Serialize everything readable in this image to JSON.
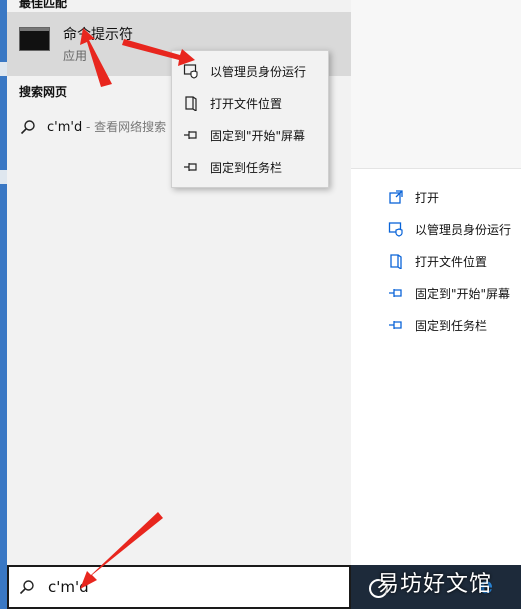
{
  "left_pane": {
    "best_match_header": "最佳匹配",
    "top_result": {
      "title": "命令提示符",
      "subtitle": "应用"
    },
    "web_header": "搜索网页",
    "web_result": {
      "query": "c'm'd",
      "hint": " - 查看网络搜索"
    }
  },
  "context_menu": {
    "items": [
      {
        "label": "以管理员身份运行",
        "icon": "shield-icon"
      },
      {
        "label": "打开文件位置",
        "icon": "file-location-icon"
      },
      {
        "label": "固定到\"开始\"屏幕",
        "icon": "pin-icon"
      },
      {
        "label": "固定到任务栏",
        "icon": "pin-icon"
      }
    ]
  },
  "right_pane": {
    "actions": [
      {
        "label": "打开",
        "icon": "open-icon"
      },
      {
        "label": "以管理员身份运行",
        "icon": "shield-icon"
      },
      {
        "label": "打开文件位置",
        "icon": "file-location-icon"
      },
      {
        "label": "固定到\"开始\"屏幕",
        "icon": "pin-icon"
      },
      {
        "label": "固定到任务栏",
        "icon": "pin-icon"
      }
    ]
  },
  "search": {
    "value": "c'm'd"
  },
  "watermark": "易坊好文馆",
  "colors": {
    "accent": "#0a64d8",
    "arrow": "#e8261e",
    "highlight": "#d9d9d9",
    "taskbar": "#1d2a3a"
  }
}
